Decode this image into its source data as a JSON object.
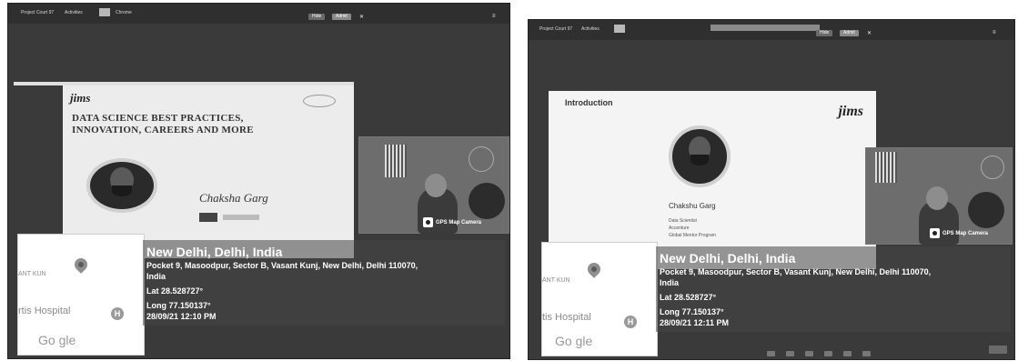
{
  "screenshots": [
    {
      "topbar": {
        "tabs": [
          "Project Court 97",
          "Activities",
          "Chrome"
        ],
        "notification": "",
        "buttons": [
          "Hide",
          "Admit"
        ]
      },
      "slide": {
        "logo": "jims",
        "title_line1": "DATA SCIENCE BEST PRACTICES,",
        "title_line2": "INNOVATION, CAREERS AND MORE",
        "signature": "Chaksha Garg"
      },
      "camera": {
        "overlay": "GPS Map Camera"
      },
      "map": {
        "place1": "ANT KUN",
        "place2": "rtis Hospital",
        "logo": "Go  gle"
      },
      "location": {
        "city": "New Delhi, Delhi, India",
        "address": "Pocket 9, Masoodpur, Sector B, Vasant Kunj, New Delhi, Delhi 110070,",
        "country": "India",
        "lat": "Lat 28.528727°",
        "long": "Long 77.150137°",
        "datetime": "28/09/21 12:10 PM"
      }
    },
    {
      "topbar": {
        "tabs": [
          "Project Court 97",
          "Activities"
        ],
        "notification": "",
        "buttons": [
          "Hide",
          "Admit"
        ]
      },
      "slide": {
        "heading": "Introduction",
        "logo": "jims",
        "name": "Chakshu Garg",
        "detail1": "Data Scientist",
        "detail2": "Accenture",
        "detail3": "Global Mentor Program"
      },
      "camera": {
        "overlay": "GPS Map Camera"
      },
      "map": {
        "place1": "ANT KUN",
        "place2": "tis Hospital",
        "logo": "Go  gle"
      },
      "location": {
        "city": "New Delhi, Delhi, India",
        "address": "Pocket 9, Masoodpur, Sector B, Vasant Kunj, New Delhi, Delhi 110070,",
        "country": "India",
        "lat": "Lat 28.528727°",
        "long": "Long 77.150137°",
        "datetime": "28/09/21 12:11 PM"
      }
    }
  ]
}
